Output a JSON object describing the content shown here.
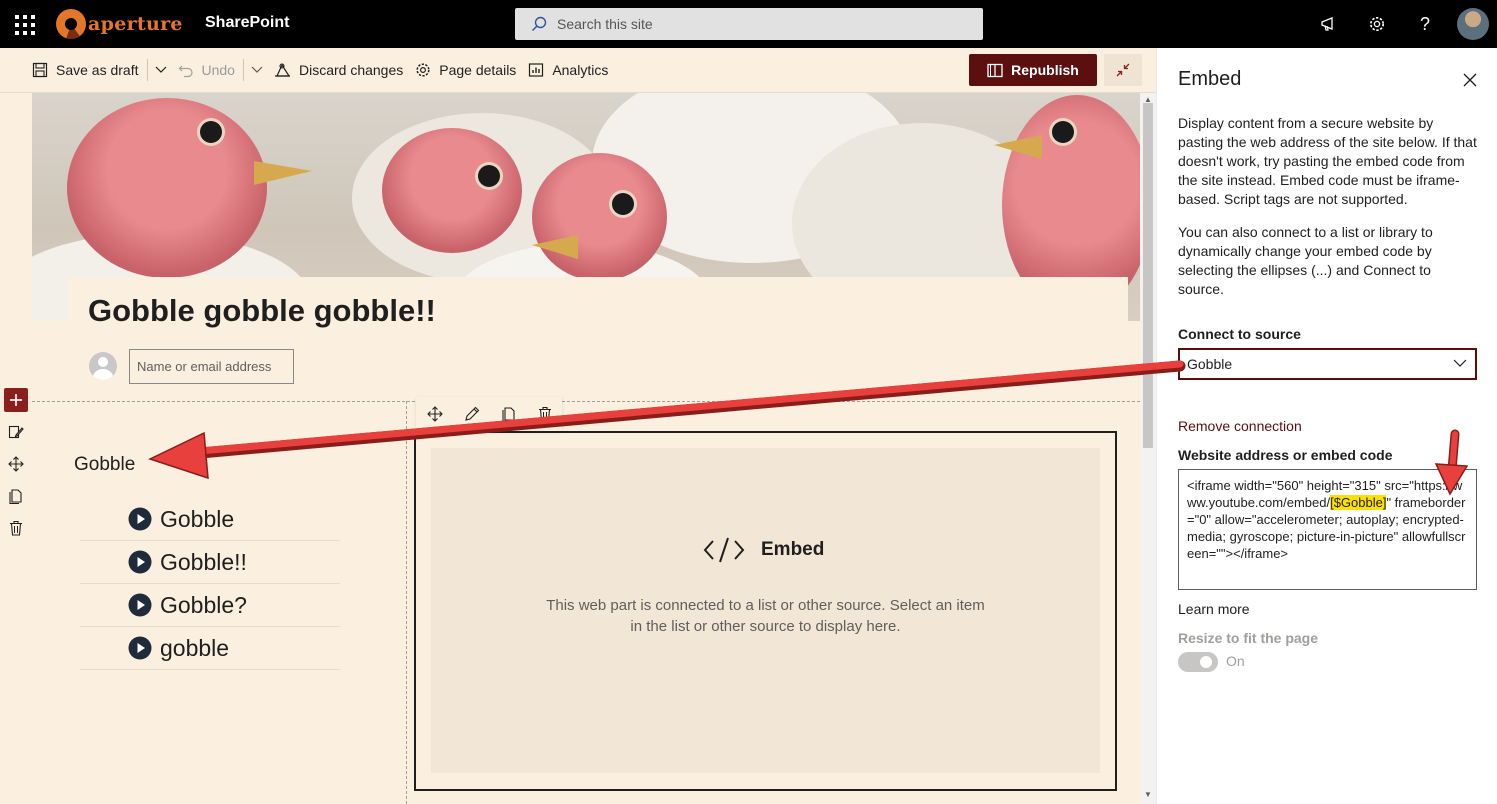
{
  "suite_bar": {
    "logo_text": "aperture",
    "app_name": "SharePoint",
    "search_placeholder": "Search this site",
    "icons": [
      "app-launcher-icon",
      "megaphone-icon",
      "gear-icon",
      "help-icon"
    ]
  },
  "command_bar": {
    "save_draft": "Save as draft",
    "undo": "Undo",
    "discard": "Discard changes",
    "page_details": "Page details",
    "analytics": "Analytics",
    "republish": "Republish"
  },
  "page": {
    "title": "Gobble gobble gobble!!",
    "author_placeholder": "Name or email address"
  },
  "list_webpart": {
    "title": "Gobble",
    "items": [
      "Gobble",
      "Gobble!!",
      "Gobble?",
      "gobble"
    ]
  },
  "embed_webpart": {
    "heading": "Embed",
    "description": "This web part is connected to a list or other source. Select an item in the list or other source to display here."
  },
  "property_pane": {
    "title": "Embed",
    "description_1": "Display content from a secure website by pasting the web address of the site below. If that doesn't work, try pasting the embed code from the site instead. Embed code must be iframe-based. Script tags are not supported.",
    "description_2": "You can also connect to a list or library to dynamically change your embed code by selecting the ellipses (...) and Connect to source.",
    "connect_label": "Connect to source",
    "connect_value": "Gobble",
    "remove_connection": "Remove connection",
    "code_label": "Website address or embed code",
    "code_before": "<iframe width=\"560\" height=\"315\" src=\"https://www.youtube.com/embed/",
    "code_highlight": "[$Gobble]",
    "code_after": "\" frameborder=\"0\" allow=\"accelerometer; autoplay; encrypted-media; gyroscope; picture-in-picture\" allowfullscreen=\"\"></iframe>",
    "learn_more": "Learn more",
    "resize_label": "Resize to fit the page",
    "resize_state": "On"
  },
  "colors": {
    "theme_dark_red": "#5b0f0f",
    "page_background": "#fbf0e0",
    "annotation_red": "#e8403c"
  }
}
